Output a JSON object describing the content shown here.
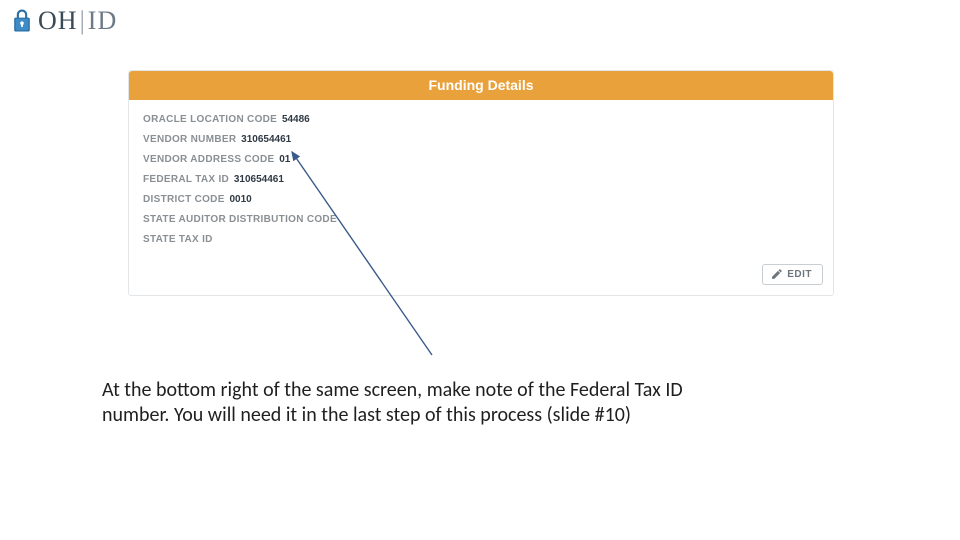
{
  "logo": {
    "oh": "OH",
    "bar": "|",
    "id": "ID"
  },
  "panel": {
    "title": "Funding Details",
    "fields": [
      {
        "label": "ORACLE LOCATION CODE",
        "value": "54486"
      },
      {
        "label": "VENDOR NUMBER",
        "value": "310654461"
      },
      {
        "label": "VENDOR ADDRESS CODE",
        "value": "01"
      },
      {
        "label": "FEDERAL TAX ID",
        "value": "310654461"
      },
      {
        "label": "DISTRICT CODE",
        "value": "0010"
      },
      {
        "label": "STATE AUDITOR DISTRIBUTION CODE",
        "value": ""
      },
      {
        "label": "STATE TAX ID",
        "value": ""
      }
    ],
    "edit_label": "EDIT"
  },
  "caption": {
    "line1": "At the bottom right of the same screen, make note of the Federal Tax ID",
    "line2": "number. You will need it in the last step of this process (slide #10)"
  }
}
